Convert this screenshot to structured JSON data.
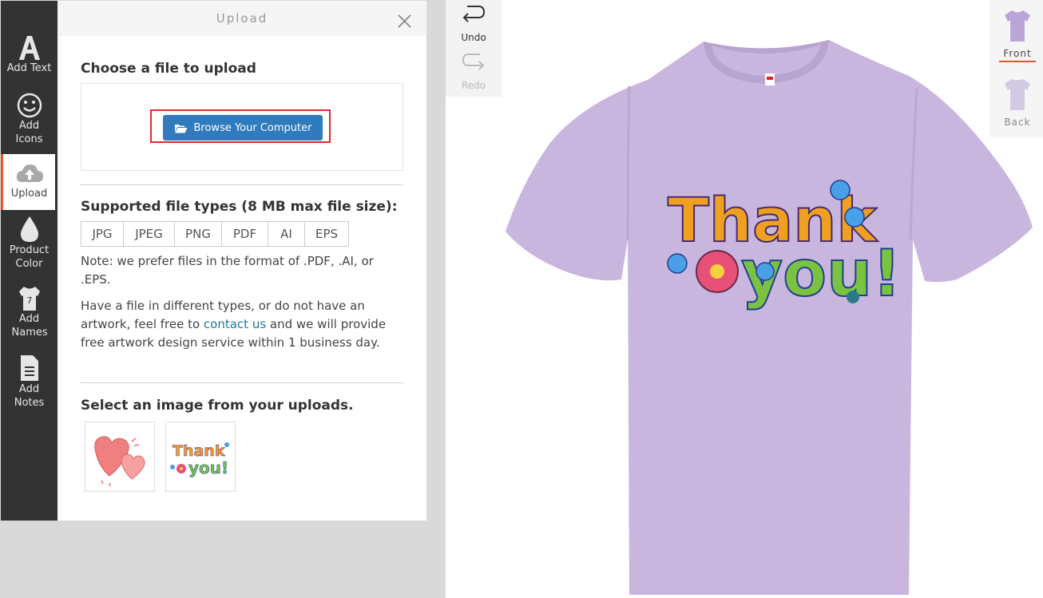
{
  "rail": {
    "add_text": "Add Text",
    "add_icons": "Add Icons",
    "upload": "Upload",
    "product_color": "Product Color",
    "add_names": "Add Names",
    "add_notes": "Add Notes",
    "active_accent": "#e8542e"
  },
  "panel": {
    "title": "Upload",
    "choose_heading": "Choose a file to upload",
    "browse_label": "Browse Your Computer",
    "supported_heading": "Supported file types (8 MB max file size):",
    "file_types": [
      "JPG",
      "JPEG",
      "PNG",
      "PDF",
      "AI",
      "EPS"
    ],
    "note": "Note: we prefer files in the format of .PDF, .AI, or .EPS.",
    "help_before": "Have a file in different types, or do not have an artwork, feel free to ",
    "help_link": "contact us",
    "help_after": " and we will provide free artwork design service within 1 business day.",
    "uploads_heading": "Select an image from your uploads.",
    "uploads": [
      {
        "icon": "hearts-image"
      },
      {
        "icon": "thank-you-image"
      }
    ]
  },
  "canvas": {
    "undo": "Undo",
    "redo": "Redo",
    "front": "Front",
    "back": "Back",
    "shirt_color": "#c8b6df",
    "design_text_1": "Thank",
    "design_text_2": "you!"
  }
}
